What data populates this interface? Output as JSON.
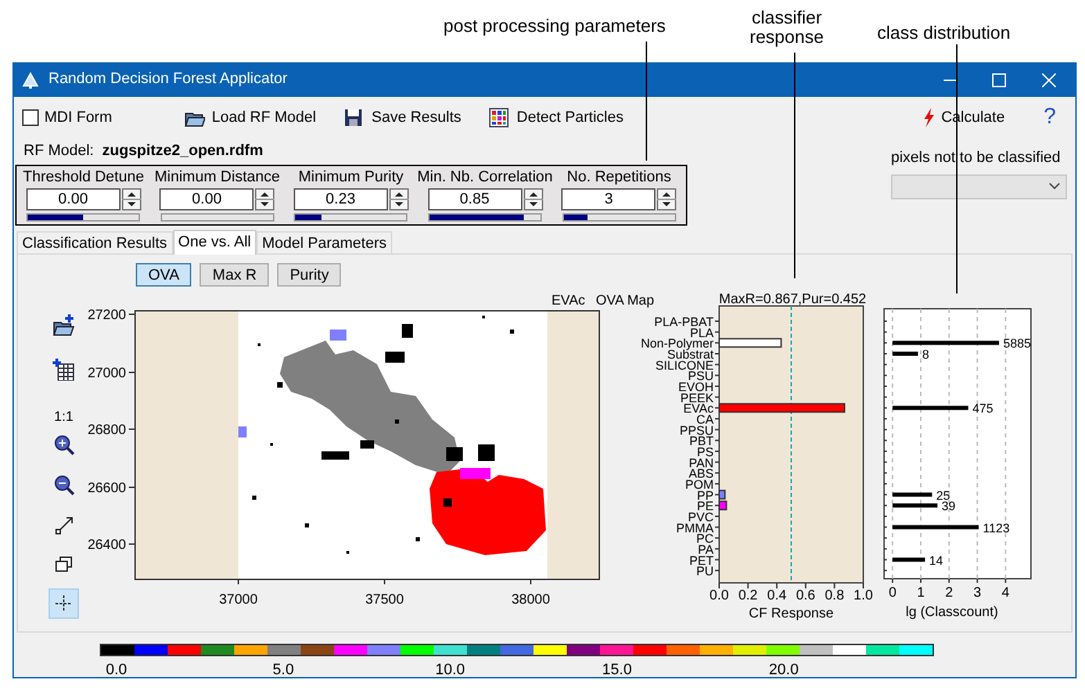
{
  "annotations": [
    {
      "text": "post processing parameters"
    },
    {
      "text": "classifier\nresponse"
    },
    {
      "text": "class distribution"
    }
  ],
  "window": {
    "title": "Random Decision Forest Applicator"
  },
  "toolbar": {
    "mdi_form": {
      "label": "MDI Form",
      "checked": false
    },
    "buttons": [
      {
        "kind": "load",
        "label": "Load RF Model"
      },
      {
        "kind": "save",
        "label": "Save Results"
      },
      {
        "kind": "detect",
        "label": "Detect Particles"
      }
    ],
    "calculate": "Calculate",
    "help": "?"
  },
  "model": {
    "label": "RF Model:",
    "file": "zugspitze2_open.rdfm"
  },
  "parameters": [
    {
      "label": "Threshold Detune",
      "value": "0.00",
      "level": 0.5
    },
    {
      "label": "Minimum Distance",
      "value": "0.00",
      "level": 0
    },
    {
      "label": "Minimum Purity",
      "value": "0.23",
      "level": 0.23
    },
    {
      "label": "Min. Nb. Correlation",
      "value": "0.85",
      "level": 0.85
    },
    {
      "label": "No. Repetitions",
      "value": "3",
      "level": 0.22
    }
  ],
  "exclusion": {
    "label": "pixels not to be classified",
    "disabled": true
  },
  "tabs": [
    {
      "label": "Classification Results",
      "selected": false
    },
    {
      "label": "One vs. All",
      "selected": true
    },
    {
      "label": "Model Parameters",
      "selected": false
    }
  ],
  "view_buttons": [
    {
      "label": "OVA",
      "selected": true
    },
    {
      "label": "Max R",
      "selected": false
    },
    {
      "label": "Purity",
      "selected": false
    }
  ],
  "map_tools": [
    {
      "kind": "add-image",
      "selected": false
    },
    {
      "kind": "add-table",
      "selected": false
    },
    {
      "kind": "text",
      "label": "1:1",
      "selected": false
    },
    {
      "kind": "zoom-in",
      "selected": false
    },
    {
      "kind": "zoom-out",
      "selected": false
    },
    {
      "kind": "resize",
      "selected": false
    },
    {
      "kind": "window",
      "selected": false
    },
    {
      "kind": "crosshair",
      "selected": true
    }
  ],
  "map": {
    "class_label": "EVAc",
    "title": "OVA Map",
    "yticks": [
      "27200",
      "27000",
      "26800",
      "26600",
      "26400"
    ],
    "xticks": [
      "37000",
      "37500",
      "38000"
    ]
  },
  "classifier_response": {
    "chart_data": {
      "type": "bar",
      "orientation": "horizontal",
      "title": "MaxR=0.867,Pur=0.452",
      "xlabel": "CF Response",
      "categories": [
        "PLA-PBAT",
        "PLA",
        "Non-Polymer",
        "Substrat",
        "SILICONE",
        "PSU",
        "EVOH",
        "PEEK",
        "EVAc",
        "CA",
        "PPSU",
        "PBT",
        "PS",
        "PAN",
        "ABS",
        "POM",
        "PP",
        "PE",
        "PVC",
        "PMMA",
        "PC",
        "PA",
        "PET",
        "PU"
      ],
      "series": [
        {
          "color": "#ffffff",
          "values": [
            null,
            null,
            0.43,
            null,
            null,
            null,
            null,
            null,
            null,
            null,
            null,
            null,
            null,
            null,
            null,
            null,
            null,
            null,
            null,
            null,
            null,
            null,
            null,
            null
          ]
        },
        {
          "color": "#ff0000",
          "values": [
            null,
            null,
            null,
            null,
            null,
            null,
            null,
            null,
            0.87,
            null,
            null,
            null,
            null,
            null,
            null,
            null,
            null,
            null,
            null,
            null,
            null,
            null,
            null,
            null
          ]
        },
        {
          "color": "#8080ff",
          "values": [
            null,
            null,
            null,
            null,
            null,
            null,
            null,
            null,
            null,
            null,
            null,
            null,
            null,
            null,
            null,
            null,
            0.04,
            null,
            null,
            null,
            null,
            null,
            null,
            null
          ]
        },
        {
          "color": "#ff00ff",
          "values": [
            null,
            null,
            null,
            null,
            null,
            null,
            null,
            null,
            null,
            null,
            null,
            null,
            null,
            null,
            null,
            null,
            null,
            0.05,
            null,
            null,
            null,
            null,
            null,
            null
          ]
        }
      ],
      "xlim": [
        0,
        1
      ],
      "xticks": [
        {
          "value": 0,
          "label": "0.0"
        },
        {
          "value": 0.2,
          "label": "0.2"
        },
        {
          "value": 0.4,
          "label": "0.4"
        },
        {
          "value": 0.6,
          "label": "0.6"
        },
        {
          "value": 0.8,
          "label": "0.8"
        },
        {
          "value": 1,
          "label": "1.0"
        }
      ],
      "ref_lines": [
        {
          "axis": "x",
          "value": 0.5
        }
      ]
    }
  },
  "class_distribution": {
    "chart_data": {
      "type": "bar",
      "orientation": "horizontal",
      "xlabel": "lg (Classcount)",
      "grid": true,
      "values": [
        null,
        null,
        3.77,
        0.9,
        null,
        null,
        null,
        null,
        2.68,
        null,
        null,
        null,
        null,
        null,
        null,
        null,
        1.4,
        1.59,
        null,
        3.05,
        null,
        null,
        1.15,
        null
      ],
      "xlim": [
        -0.3,
        4.9
      ],
      "xticks": [
        0,
        1,
        2,
        3,
        4
      ]
    },
    "count_labels": [
      "5885",
      "8",
      "475",
      "25",
      "39",
      "1123",
      "14"
    ]
  },
  "colorbar": {
    "swatches": [
      {
        "color": "#000000"
      },
      {
        "color": "#0000ff"
      },
      {
        "color": "#ff0000"
      },
      {
        "color": "#1f8a1f"
      },
      {
        "color": "#ffa500"
      },
      {
        "color": "#808080"
      },
      {
        "color": "#8b4513"
      },
      {
        "color": "#ff00ff"
      },
      {
        "color": "#8080ff"
      },
      {
        "color": "#00ff00"
      },
      {
        "color": "#40e0d0"
      },
      {
        "color": "#008080"
      },
      {
        "color": "#4169e1"
      },
      {
        "color": "#ffff00"
      },
      {
        "color": "#800080"
      },
      {
        "color": "#ff1493"
      },
      {
        "color": "#ff0000"
      },
      {
        "color": "#ff6000"
      },
      {
        "color": "#ffb000"
      },
      {
        "color": "#e0f000"
      },
      {
        "color": "#80ff00"
      },
      {
        "color": "#c0c0c0"
      },
      {
        "color": "#ffffff"
      },
      {
        "color": "#00e8a0"
      },
      {
        "color": "#00ffff"
      }
    ],
    "labels": [
      "0.0",
      "5.0",
      "10.0",
      "15.0",
      "20.0"
    ]
  }
}
